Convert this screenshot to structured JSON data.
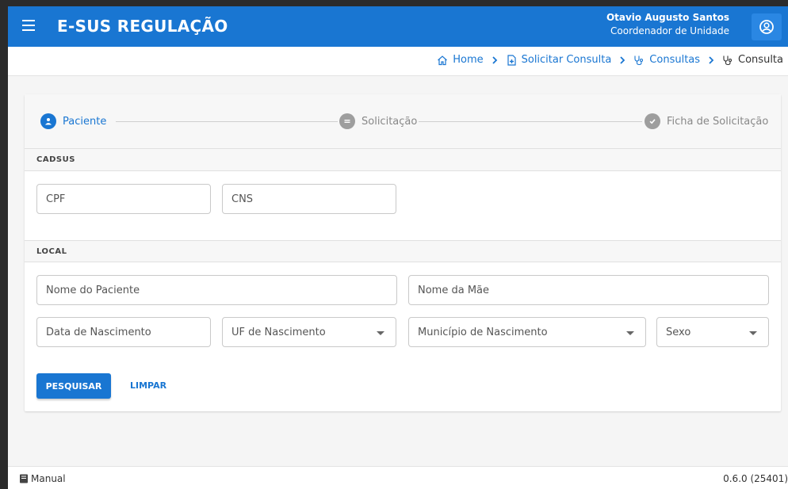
{
  "app": {
    "title": "E-SUS REGULAÇÃO",
    "accent_color": "#1976d2"
  },
  "header": {
    "menu_icon": "hamburger-menu-icon",
    "user_name": "Otavio Augusto Santos",
    "user_role": "Coordenador de Unidade",
    "user_icon": "account-circle-icon"
  },
  "breadcrumb": {
    "items": [
      {
        "label": "Home",
        "icon": "home-icon"
      },
      {
        "label": "Solicitar Consulta",
        "icon": "document-add-icon"
      },
      {
        "label": "Consultas",
        "icon": "stethoscope-icon"
      },
      {
        "label": "Consulta",
        "icon": "stethoscope-icon"
      }
    ]
  },
  "stepper": {
    "steps": [
      {
        "label": "Paciente",
        "state": "active",
        "icon": "person-icon"
      },
      {
        "label": "Solicitação",
        "state": "pending",
        "icon": "list-icon"
      },
      {
        "label": "Ficha de Solicitação",
        "state": "pending",
        "icon": "check-icon"
      }
    ]
  },
  "sections": {
    "cadsus": "CADSUS",
    "local": "LOCAL"
  },
  "fields": {
    "cpf": {
      "placeholder": "CPF",
      "value": ""
    },
    "cns": {
      "placeholder": "CNS",
      "value": ""
    },
    "nome_paciente": {
      "placeholder": "Nome do Paciente",
      "value": ""
    },
    "nome_mae": {
      "placeholder": "Nome da Mãe",
      "value": ""
    },
    "data_nascimento": {
      "placeholder": "Data de Nascimento",
      "value": ""
    },
    "uf_nascimento": {
      "placeholder": "UF de Nascimento",
      "value": ""
    },
    "municipio_nascimento": {
      "placeholder": "Município de Nascimento",
      "value": ""
    },
    "sexo": {
      "placeholder": "Sexo",
      "value": ""
    }
  },
  "actions": {
    "search_label": "PESQUISAR",
    "clear_label": "LIMPAR"
  },
  "footer": {
    "manual_label": "Manual",
    "version": "0.6.0 (25401)"
  }
}
